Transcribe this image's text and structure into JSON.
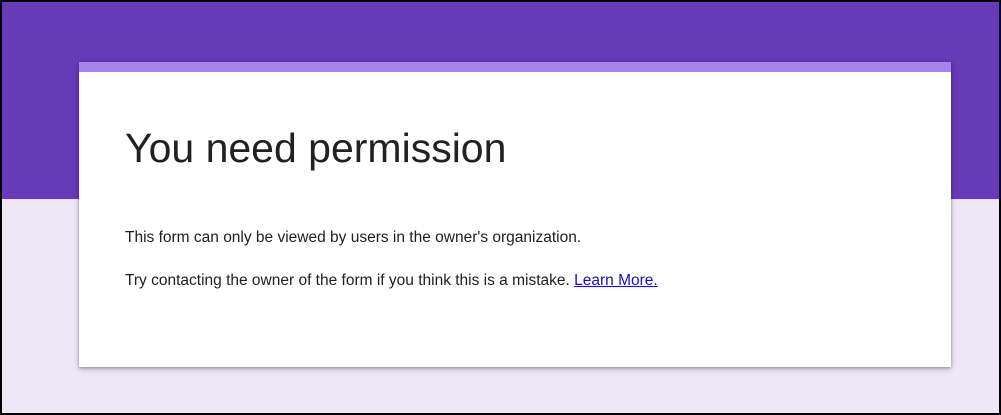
{
  "theme": {
    "header_color": "#673ab7",
    "accent_color": "#a684ed",
    "background_color": "#ede7f6",
    "link_color": "#1a0dcc"
  },
  "card": {
    "title": "You need permission",
    "message_line_1": "This form can only be viewed by users in the owner's organization.",
    "message_line_2": "Try contacting the owner of the form if you think this is a mistake.",
    "learn_more_label": "Learn More."
  }
}
